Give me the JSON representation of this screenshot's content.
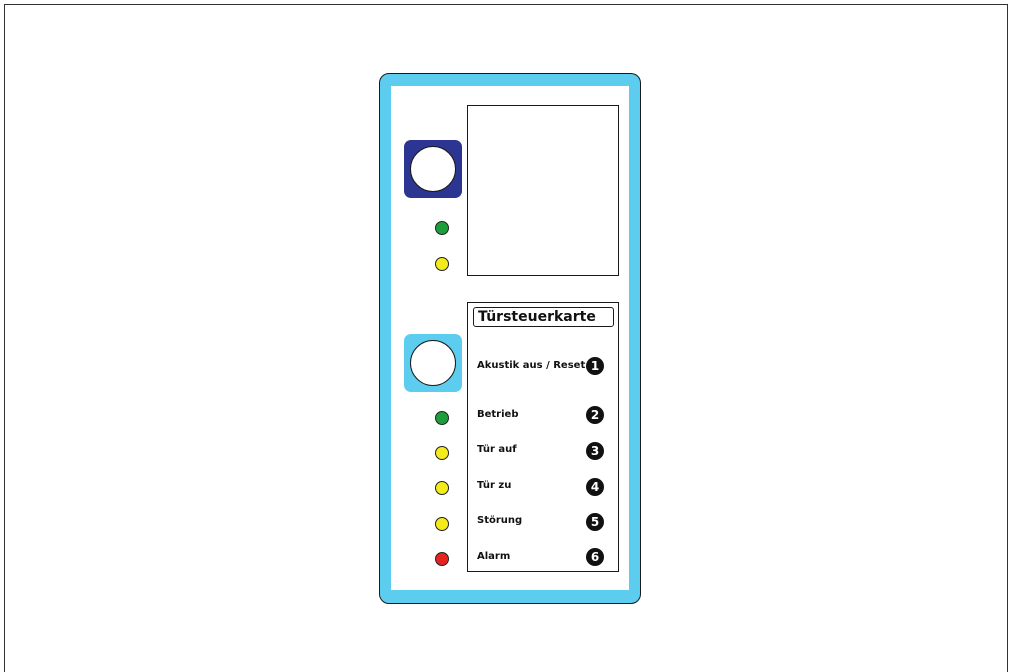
{
  "title": "Türsteuerkarte",
  "rows": [
    {
      "label": "Akustik aus / Reset",
      "number": "1"
    },
    {
      "label": "Betrieb",
      "number": "2"
    },
    {
      "label": "Tür auf",
      "number": "3"
    },
    {
      "label": "Tür zu",
      "number": "4"
    },
    {
      "label": "Störung",
      "number": "5"
    },
    {
      "label": "Alarm",
      "number": "6"
    }
  ],
  "colors": {
    "panel_frame": "#5ccdee",
    "top_button": "#2d3592",
    "bottom_button": "#5ccdee",
    "led_green": "#1e9e3a",
    "led_yellow": "#f4eb1a",
    "led_red": "#e52421"
  },
  "leds_top": [
    "green",
    "yellow"
  ],
  "leds_bottom": [
    "green",
    "yellow",
    "yellow",
    "yellow",
    "red"
  ]
}
